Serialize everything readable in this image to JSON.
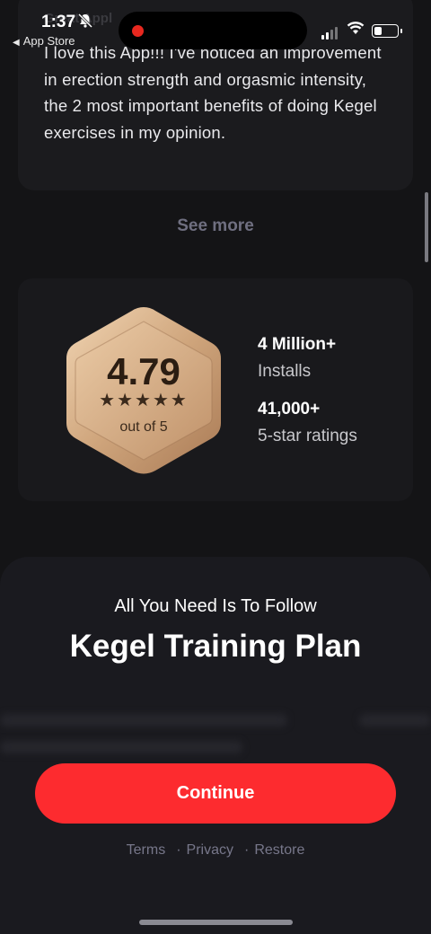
{
  "status_bar": {
    "time": "1:37",
    "back_label": "App Store",
    "battery_level": 0.35,
    "recording_dot_color": "#e8281f"
  },
  "review": {
    "author": "Great Appl",
    "text": "I love this App!!! I've noticed an improvement in erection strength and orgasmic intensity, the 2 most important benefits of doing Kegel exercises in my opinion."
  },
  "see_more_label": "See more",
  "rating_badge": {
    "score": "4.79",
    "stars": "★★★★★",
    "out_of": "out of 5"
  },
  "stats": [
    {
      "value": "4 Million+",
      "label": "Installs"
    },
    {
      "value": "41,000+",
      "label": "5-star ratings"
    }
  ],
  "plan": {
    "subtitle": "All You Need Is To Follow",
    "title": "Kegel Training Plan"
  },
  "continue_label": "Continue",
  "footer_links": [
    "Terms",
    "Privacy",
    "Restore"
  ],
  "colors": {
    "background": "#141416",
    "accent": "#fd2b2f",
    "badge_gold": "#c9a079"
  }
}
